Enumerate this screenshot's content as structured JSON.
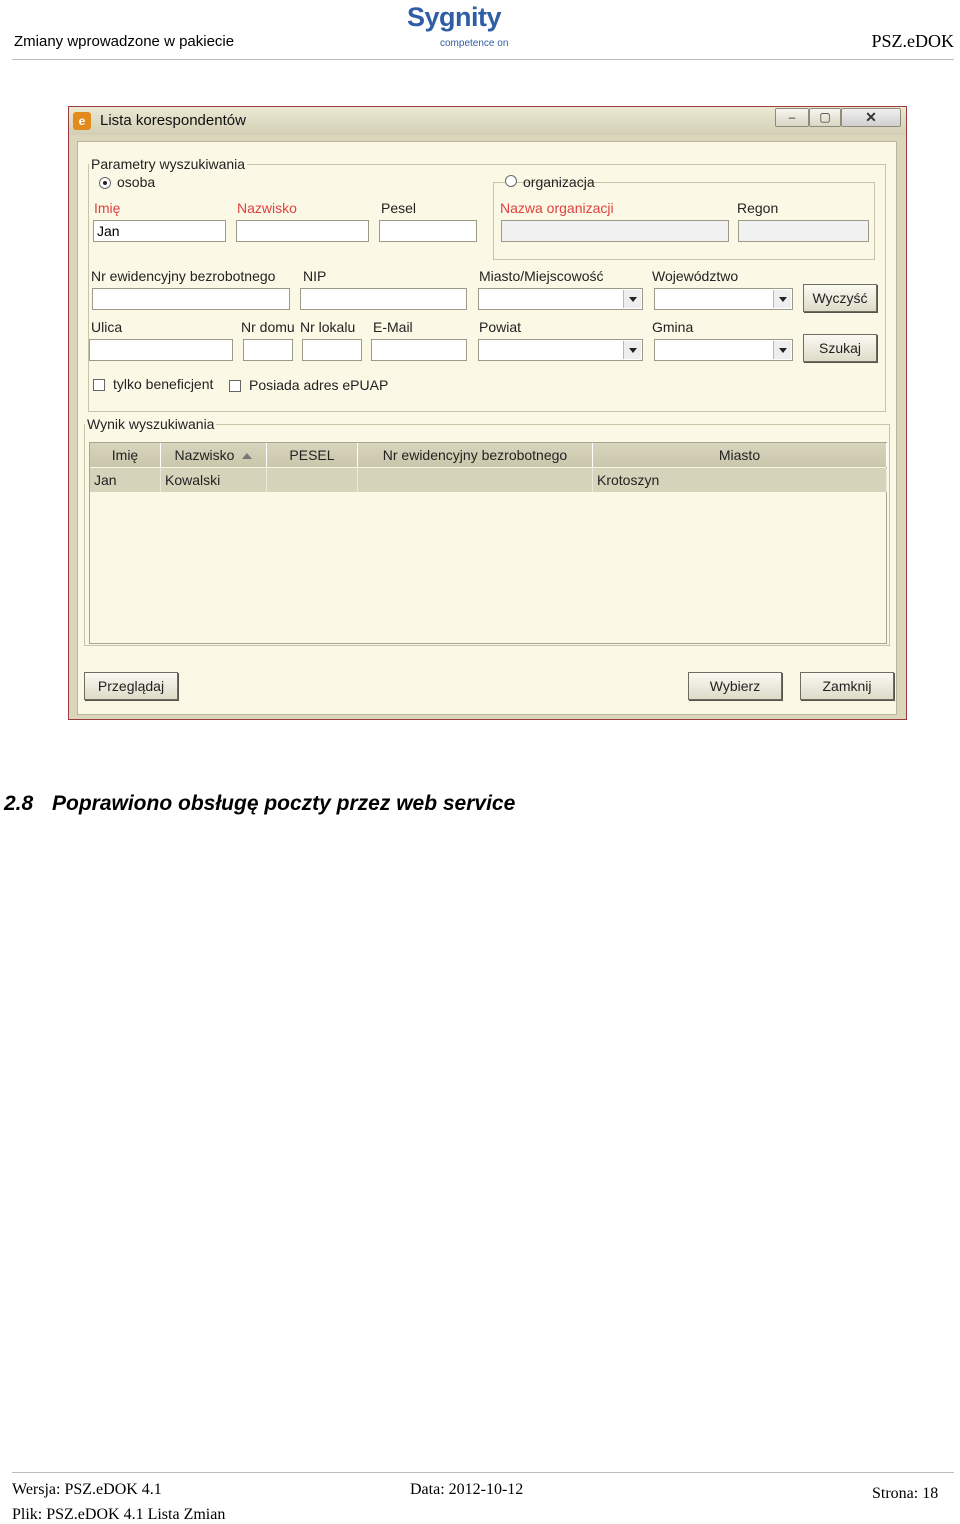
{
  "page_header": {
    "left": "Zmiany wprowadzone w pakiecie",
    "right": "PSZ.eDOK"
  },
  "logo": {
    "name": "Sygnity",
    "tagline": "competence on"
  },
  "window": {
    "title": "Lista korespondentów",
    "buttons": {
      "minimize": "–",
      "maximize": "▢",
      "close": "✕"
    },
    "search_group": {
      "legend": "Parametry wyszukiwania",
      "radio_person": "osoba",
      "radio_org": "organizacja",
      "labels": {
        "first_name": "Imię",
        "last_name": "Nazwisko",
        "pesel": "Pesel",
        "org_name": "Nazwa organizacji",
        "regon": "Regon",
        "unemployed_no": "Nr ewidencyjny bezrobotnego",
        "nip": "NIP",
        "city": "Miasto/Miejscowość",
        "voivodeship": "Województwo",
        "street": "Ulica",
        "house_no": "Nr domu",
        "apt_no": "Nr lokalu",
        "email": "E-Mail",
        "county": "Powiat",
        "commune": "Gmina"
      },
      "values": {
        "first_name": "Jan"
      },
      "btn_clear": "Wyczyść",
      "btn_search": "Szukaj",
      "check_beneficiary": "tylko beneficjent",
      "check_epuap": "Posiada adres ePUAP"
    },
    "results_group": {
      "legend": "Wynik wyszukiwania",
      "columns": [
        "Imię",
        "Nazwisko",
        "PESEL",
        "Nr ewidencyjny bezrobotnego",
        "Miasto"
      ],
      "rows": [
        [
          "Jan",
          "Kowalski",
          "",
          "",
          "Krotoszyn"
        ]
      ]
    },
    "btn_browse": "Przeglądaj",
    "btn_choose": "Wybierz",
    "btn_close": "Zamknij"
  },
  "section": {
    "number": "2.8",
    "title": "Poprawiono obsługę poczty przez web service"
  },
  "footer": {
    "version": "Wersja: PSZ.eDOK 4.1",
    "date": "Data: 2012-10-12",
    "page": "Strona: 18",
    "file": "Plik: PSZ.eDOK 4.1 Lista Zmian"
  },
  "colors": {
    "required_label": "#e04040",
    "logo": "#2f5ea6",
    "window_bg": "#fbf9e6"
  }
}
